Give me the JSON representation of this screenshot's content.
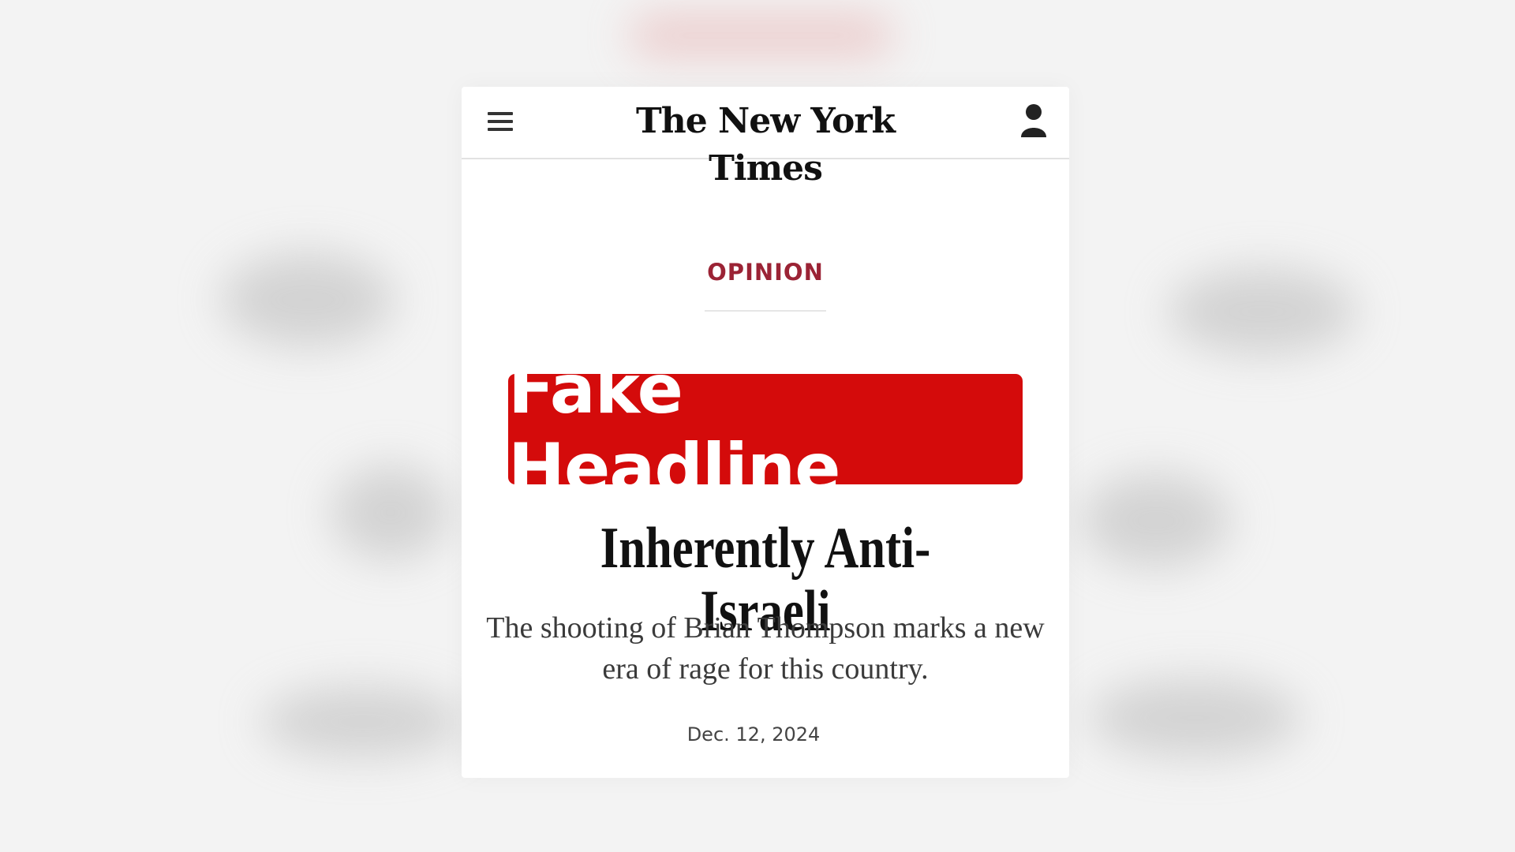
{
  "masthead": {
    "logo_text": "The New York Times",
    "menu_icon": "hamburger-menu-icon",
    "account_icon": "user-icon"
  },
  "article": {
    "section": "OPINION",
    "headline_line2": "Inherently Anti-Israeli",
    "deck": "The shooting of Brian Thompson marks a new era of rage for this country.",
    "date": "Dec. 12, 2024"
  },
  "overlay": {
    "label": "Fake Headline",
    "color": "#d40b0b"
  },
  "colors": {
    "section_label": "#9b2335",
    "background": "#f3f3f3",
    "card": "#ffffff"
  }
}
